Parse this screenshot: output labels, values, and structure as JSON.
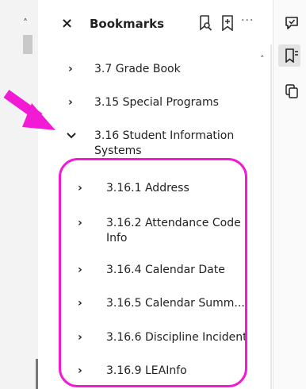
{
  "panel": {
    "title": "Bookmarks",
    "close_glyph": "×",
    "more_glyph": "···",
    "header_icons": [
      "bookmark-search-icon",
      "add-bookmark-icon",
      "more-options-icon"
    ]
  },
  "bookmarks": [
    {
      "label": "3.7  Grade Book",
      "expanded": false
    },
    {
      "label": "3.15 Special Programs",
      "expanded": false
    },
    {
      "label": "3.16  Student Information Systems",
      "expanded": true,
      "children": [
        {
          "label": "3.16.1  Address"
        },
        {
          "label": "3.16.2  Attendance Code Info"
        },
        {
          "label": "3.16.4  Calendar Date"
        },
        {
          "label": "3.16.5  Calendar Summ..."
        },
        {
          "label": "3.16.6  Discipline Incident"
        },
        {
          "label": "3.16.9  LEAInfo"
        }
      ]
    }
  ],
  "right_strip_icons": [
    "comment-icon",
    "bookmarks-panel-icon",
    "copy-pages-icon"
  ],
  "annotation": {
    "color": "#f21ad4"
  }
}
